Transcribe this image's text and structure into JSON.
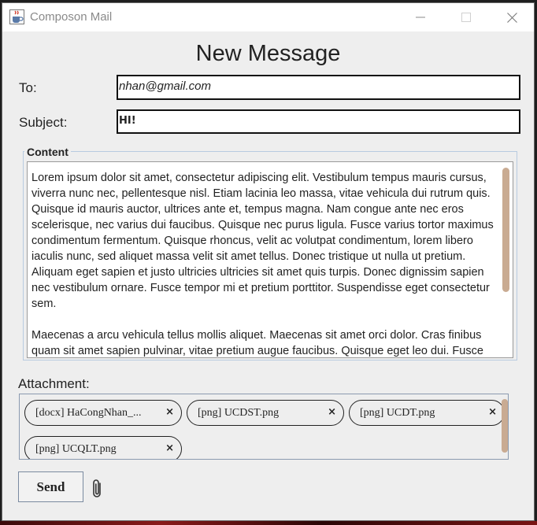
{
  "window": {
    "title": "Composon Mail",
    "icons": {
      "app": "java-cup-icon",
      "minimize": "minimize-icon",
      "maximize": "maximize-icon",
      "close": "close-icon"
    }
  },
  "form": {
    "heading": "New Message",
    "to_label": "To:",
    "to_value": "nhan@gmail.com",
    "subject_label": "Subject:",
    "subject_value": "HI!",
    "content_label": "Content",
    "content_text": "Lorem ipsum dolor sit amet, consectetur adipiscing elit. Vestibulum tempus mauris cursus,\nviverra nunc nec, pellentesque nisl. Etiam lacinia leo massa, vitae vehicula dui rutrum quis.\nQuisque id mauris auctor, ultrices ante et, tempus magna. Nam congue ante nec eros\nscelerisque, nec varius dui faucibus. Quisque nec purus ligula. Fusce varius tortor maximus\ncondimentum fermentum. Quisque rhoncus, velit ac volutpat condimentum, lorem libero\niaculis nunc, sed aliquet massa velit sit amet tellus. Donec tristique ut nulla ut pretium.\nAliquam eget sapien et justo ultricies ultricies sit amet quis turpis. Donec dignissim sapien\nnec vestibulum ornare. Fusce tempor mi et pretium porttitor. Suspendisse eget consectetur\nsem.\n\nMaecenas a arcu vehicula tellus mollis aliquet. Maecenas sit amet orci dolor. Cras finibus\nquam sit amet sapien pulvinar, vitae pretium augue faucibus. Quisque eget leo dui. Fusce",
    "attachment_label": "Attachment:",
    "attachments": [
      {
        "name": "[docx] HaCongNhan_...",
        "remove": "×"
      },
      {
        "name": "[png] UCDST.png",
        "remove": "×"
      },
      {
        "name": "[png] UCDT.png",
        "remove": "×"
      },
      {
        "name": "[png] UCQLT.png",
        "remove": "×"
      }
    ],
    "send_label": "Send",
    "attach_icon": "paperclip-icon"
  },
  "colors": {
    "scroll_thumb": "#c9ab92",
    "window_bg": "#eeeeee"
  }
}
